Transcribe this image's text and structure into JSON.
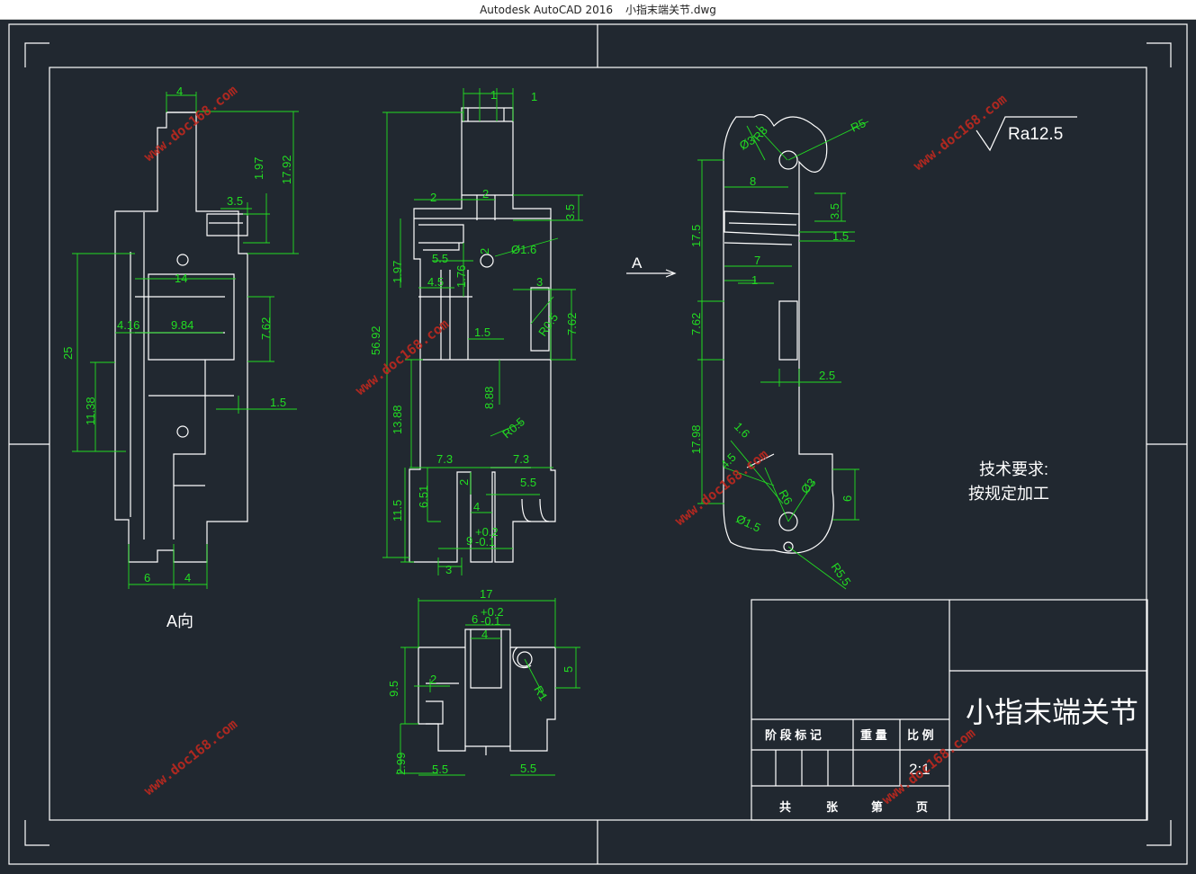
{
  "window": {
    "app_name": "Autodesk AutoCAD 2016",
    "file_name": "小指末端关节.dwg"
  },
  "drawing": {
    "colors": {
      "background": "#212830",
      "geometry": "#ffffff",
      "dimension": "#22dd22",
      "watermark": "#c8281e"
    },
    "watermark": "www.doc168.com",
    "view_a_label": "A向",
    "arrow_label": "A",
    "roughness": "Ra12.5",
    "tech_title": "技术要求:",
    "tech_body": "按规定加工",
    "dims": {
      "a1": "4",
      "a2": "1.97",
      "a3": "17.92",
      "a4": "3.5",
      "a5": "14",
      "a6": "4.16",
      "a7": "9.84",
      "a8": "7.62",
      "a9": "25",
      "a10": "11.38",
      "a11": "1.5",
      "a12": "6",
      "a13": "4",
      "f1": "1",
      "f2": "1",
      "f3": "2",
      "f4": "2",
      "f5": "3.5",
      "f6": "Ø1.6",
      "f7": "2",
      "f8": "1.97",
      "f9": "5.5",
      "f10": "1.76",
      "f11": "4.5",
      "f12": "3",
      "f13": "R0.5",
      "f14": "7.62",
      "f15": "1.5",
      "f16": "56.92",
      "f17": "8.88",
      "f18": "R0.5",
      "f19": "13.88",
      "f20": "7.3",
      "f21": "7.3",
      "f22": "2",
      "f23": "5.5",
      "f24": "6.51",
      "f25": "4",
      "f26": "11.5",
      "f27": "9",
      "f28": "+0.2",
      "f29": "-0.1",
      "f30": "3",
      "s1": "R8",
      "s2": "Ø3",
      "s3": "R5",
      "s4": "8",
      "s5": "3.5",
      "s6": "17.5",
      "s7": "1.5",
      "s8": "7",
      "s9": "1",
      "s10": "7.62",
      "s11": "2.5",
      "s12": "1.6",
      "s13": "17.98",
      "s14": "4.5",
      "s15": "R6",
      "s16": "Ø3",
      "s17": "6",
      "s18": "Ø1.5",
      "s19": "R5.5",
      "t1": "17",
      "t2": "6",
      "t3": "+0.2",
      "t4": "-0.1",
      "t5": "4",
      "t6": "9.5",
      "t7": "2",
      "t8": "5",
      "t9": "R1",
      "t10": "2.99",
      "t11": "5.5",
      "t12": "5.5"
    },
    "title_block": {
      "part_name": "小指末端关节",
      "stage": "阶 段 标 记",
      "weight": "重 量",
      "scale_label": "比 例",
      "scale_value": "2:1",
      "total": "共",
      "sheets": "张",
      "number": "第",
      "page": "页"
    }
  }
}
